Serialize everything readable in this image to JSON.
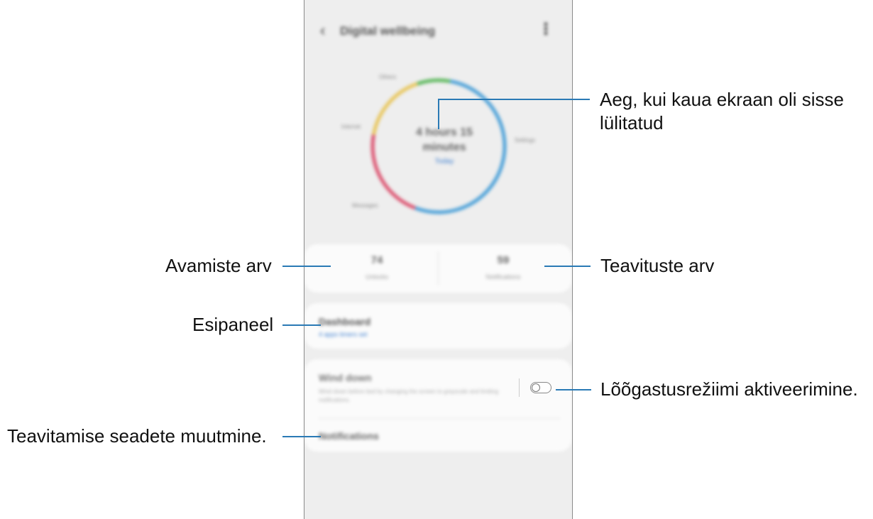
{
  "app": {
    "title": "Digital wellbeing",
    "back_icon": "back-arrow-icon",
    "more_icon": "more-vert-icon"
  },
  "ring": {
    "time_line1": "4 hours 15",
    "time_line2": "minutes",
    "subtitle": "Today",
    "labels": [
      "Others",
      "Internet",
      "Settings",
      "Messages"
    ],
    "segments": [
      {
        "color": "#4aa0d8",
        "fraction": 0.53
      },
      {
        "color": "#dc5370",
        "fraction": 0.22
      },
      {
        "color": "#e8c65c",
        "fraction": 0.17
      },
      {
        "color": "#5cb85c",
        "fraction": 0.08
      }
    ]
  },
  "stats": {
    "unlocks_value": "74",
    "unlocks_label": "Unlocks",
    "notifications_value": "59",
    "notifications_label": "Notifications"
  },
  "dashboard": {
    "title": "Dashboard",
    "subtitle": "4 apps timers set"
  },
  "wind_down": {
    "title": "Wind down",
    "description": "Wind down before bed by changing the screen to grayscale and limiting notifications.",
    "enabled": false,
    "notifications_label": "Notifications"
  },
  "callouts": {
    "screen_time_line1": "Aeg, kui kaua ekraan oli sisse",
    "screen_time_line2": "lülitatud",
    "unlocks": "Avamiste arv",
    "notifications": "Teavituste arv",
    "dashboard": "Esipaneel",
    "wind_down": "Lõõgastusrežiimi aktiveerimine.",
    "notification_settings": "Teavitamise seadete muutmine."
  },
  "colors": {
    "callout_line": "#2a7ab5",
    "link_blue": "#3e7fd0",
    "phone_bg": "#eeeeee"
  }
}
